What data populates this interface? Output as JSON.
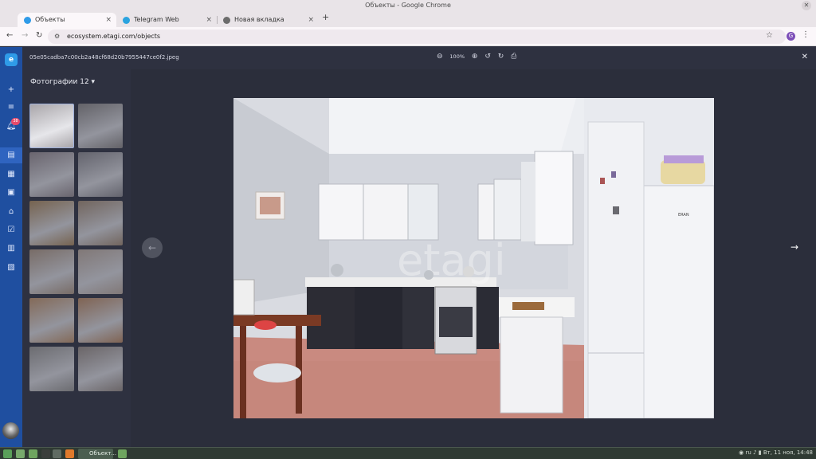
{
  "window": {
    "title": "Объекты - Google Chrome"
  },
  "tabs": [
    {
      "label": "Объекты",
      "active": true
    },
    {
      "label": "Telegram Web",
      "active": false
    },
    {
      "label": "Новая вкладка",
      "active": false
    }
  ],
  "address": {
    "url": "ecosystem.etagi.com/objects"
  },
  "profile": {
    "initial": "G"
  },
  "sidebar": {
    "notifications_count": "38"
  },
  "viewer": {
    "filename": "05e05cadba7c00cb2a48cf68d20b7955447ce0f2.jpeg",
    "zoom": "100%",
    "photos_label": "Фотографии 12",
    "watermark": "etagi"
  },
  "photo": {
    "fridge_brand": "ERAN"
  },
  "thumbnails": [
    {
      "tone": "#a9a6aa"
    },
    {
      "tone": "#8e8a88"
    },
    {
      "tone": "#9a8f94"
    },
    {
      "tone": "#8f8d92"
    },
    {
      "tone": "#b08b5c"
    },
    {
      "tone": "#a88f76"
    },
    {
      "tone": "#b49c86"
    },
    {
      "tone": "#c4b2a4"
    },
    {
      "tone": "#c9986c"
    },
    {
      "tone": "#c28c62"
    },
    {
      "tone": "#9e9c98"
    },
    {
      "tone": "#9b8f87"
    }
  ],
  "taskbar": {
    "task_label": "Объект...",
    "lang": "ru",
    "datetime": "Вт, 11 ноя, 14:48"
  },
  "colors": {
    "sidebar": "#1f4fa0",
    "viewer_bg": "#2e3140",
    "accent": "#2f9be8"
  }
}
